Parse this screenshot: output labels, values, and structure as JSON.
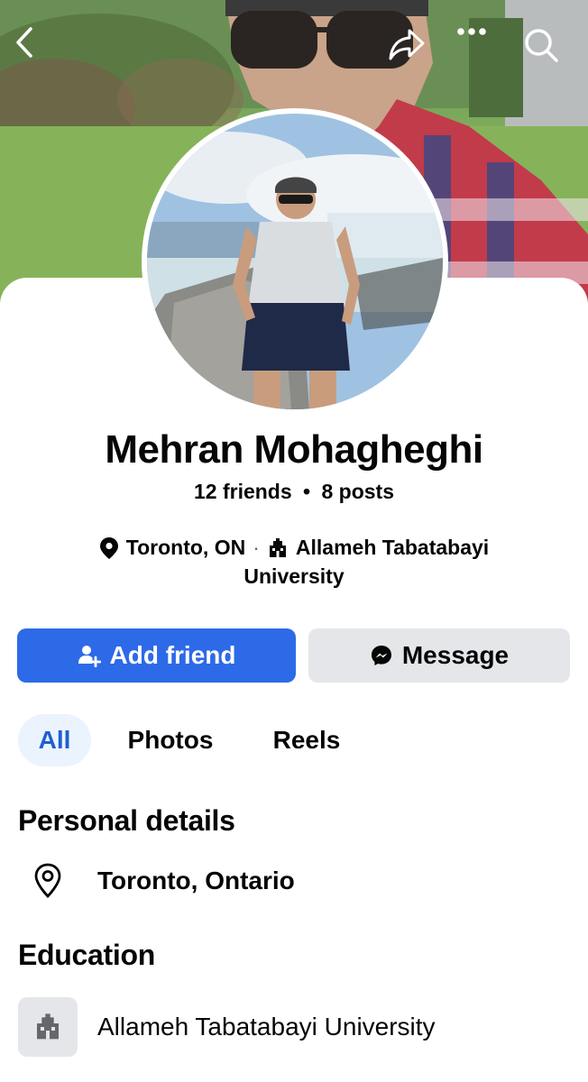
{
  "profile": {
    "name": "Mehran Mohagheghi",
    "friends": "12 friends",
    "separator": "•",
    "posts": "8 posts",
    "location_short": "Toronto, ON",
    "dot": "·",
    "school_line1": "Allameh Tabatabayi",
    "school_line2": "University"
  },
  "actions": {
    "add_friend": "Add friend",
    "message": "Message"
  },
  "tabs": [
    {
      "label": "All",
      "active": true
    },
    {
      "label": "Photos",
      "active": false
    },
    {
      "label": "Reels",
      "active": false
    }
  ],
  "personal_details": {
    "title": "Personal details",
    "location": "Toronto, Ontario"
  },
  "education": {
    "title": "Education",
    "school": "Allameh Tabatabayi University"
  },
  "top_bar_icons": [
    "back-icon",
    "share-icon",
    "more-icon",
    "search-icon"
  ],
  "colors": {
    "primary": "#2d6ae8",
    "tab_active_bg": "#ebf3fe",
    "tab_active_text": "#1f5fd1",
    "secondary_button": "#e4e6ea"
  }
}
